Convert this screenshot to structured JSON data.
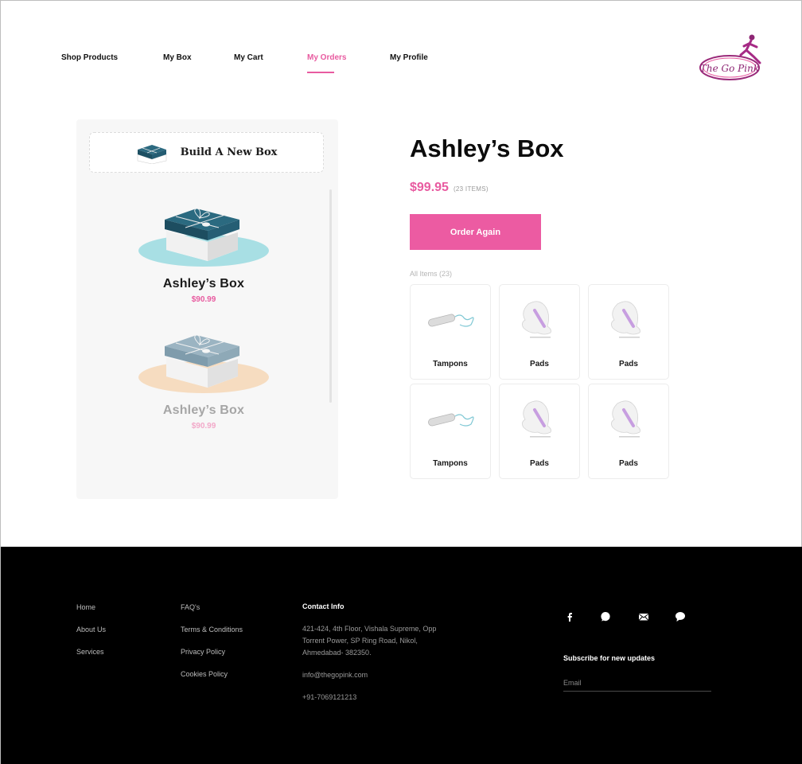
{
  "nav": {
    "items": [
      {
        "label": "Shop Products",
        "active": false
      },
      {
        "label": "My Box",
        "active": false
      },
      {
        "label": "My Cart",
        "active": false
      },
      {
        "label": "My Orders",
        "active": true
      },
      {
        "label": "My Profile",
        "active": false
      }
    ],
    "logo_text": "The Go Pink"
  },
  "left_panel": {
    "build_label": "Build A New Box",
    "boxes": [
      {
        "name": "Ashley’s Box",
        "price": "$90.99",
        "selected": true
      },
      {
        "name": "Ashley’s Box",
        "price": "$90.99",
        "selected": false
      }
    ]
  },
  "order": {
    "title": "Ashley’s Box",
    "price": "$99.95",
    "items_count": "(23 ITEMS)",
    "order_again_label": "Order Again",
    "all_items_label": "All Items (23)",
    "items": [
      {
        "label": "Tampons",
        "icon": "tampon-icon"
      },
      {
        "label": "Pads",
        "icon": "pad-icon"
      },
      {
        "label": "Pads",
        "icon": "pad-icon"
      },
      {
        "label": "Tampons",
        "icon": "tampon-icon"
      },
      {
        "label": "Pads",
        "icon": "pad-icon"
      },
      {
        "label": "Pads",
        "icon": "pad-icon"
      }
    ]
  },
  "footer": {
    "col1": [
      "Home",
      "About Us",
      "Services"
    ],
    "col2": [
      "FAQ's",
      "Terms & Conditions",
      "Privacy Policy",
      "Cookies Policy"
    ],
    "contact_heading": "Contact Info",
    "address_lines": [
      "421-424, 4th Floor, Vishala Supreme, Opp",
      "Torrent Power, SP Ring Road, Nikol,",
      "Ahmedabad- 382350."
    ],
    "email": "info@thegopink.com",
    "phone": "+91-7069121213",
    "social_icons": [
      "facebook-icon",
      "whatsapp-icon",
      "mail-icon",
      "chat-icon"
    ],
    "subscribe_heading": "Subscribe for new updates",
    "email_placeholder": "Email"
  },
  "colors": {
    "accent": "#ec5ba2",
    "box_teal_plate": "#a8dfe4",
    "box_peach_plate": "#f6dcc0",
    "box_dark_lid": "#22566b",
    "footer_bg": "#000000"
  }
}
